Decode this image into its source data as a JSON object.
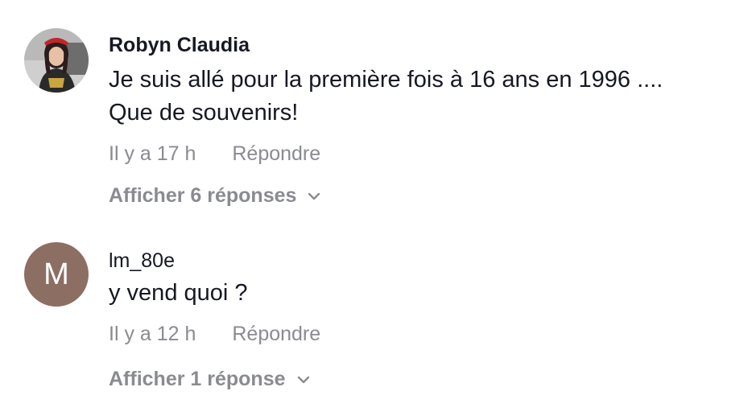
{
  "comments": [
    {
      "author": "Robyn Claudia",
      "text_line1": "Je suis allé pour la première fois à 16 ans en 1996 ....",
      "text_line2": "Que de souvenirs!",
      "time": "Il y a 17 h",
      "reply_label": "Répondre",
      "view_replies": "Afficher 6 réponses"
    },
    {
      "author": "lm_80e",
      "avatar_letter": "M",
      "text_line1": "y vend quoi ?",
      "time": "Il y a 12 h",
      "reply_label": "Répondre",
      "view_replies": "Afficher 1 réponse"
    }
  ],
  "colors": {
    "text": "#161823",
    "muted": "#8a8b91",
    "avatar_bg": "#8c6e63"
  }
}
